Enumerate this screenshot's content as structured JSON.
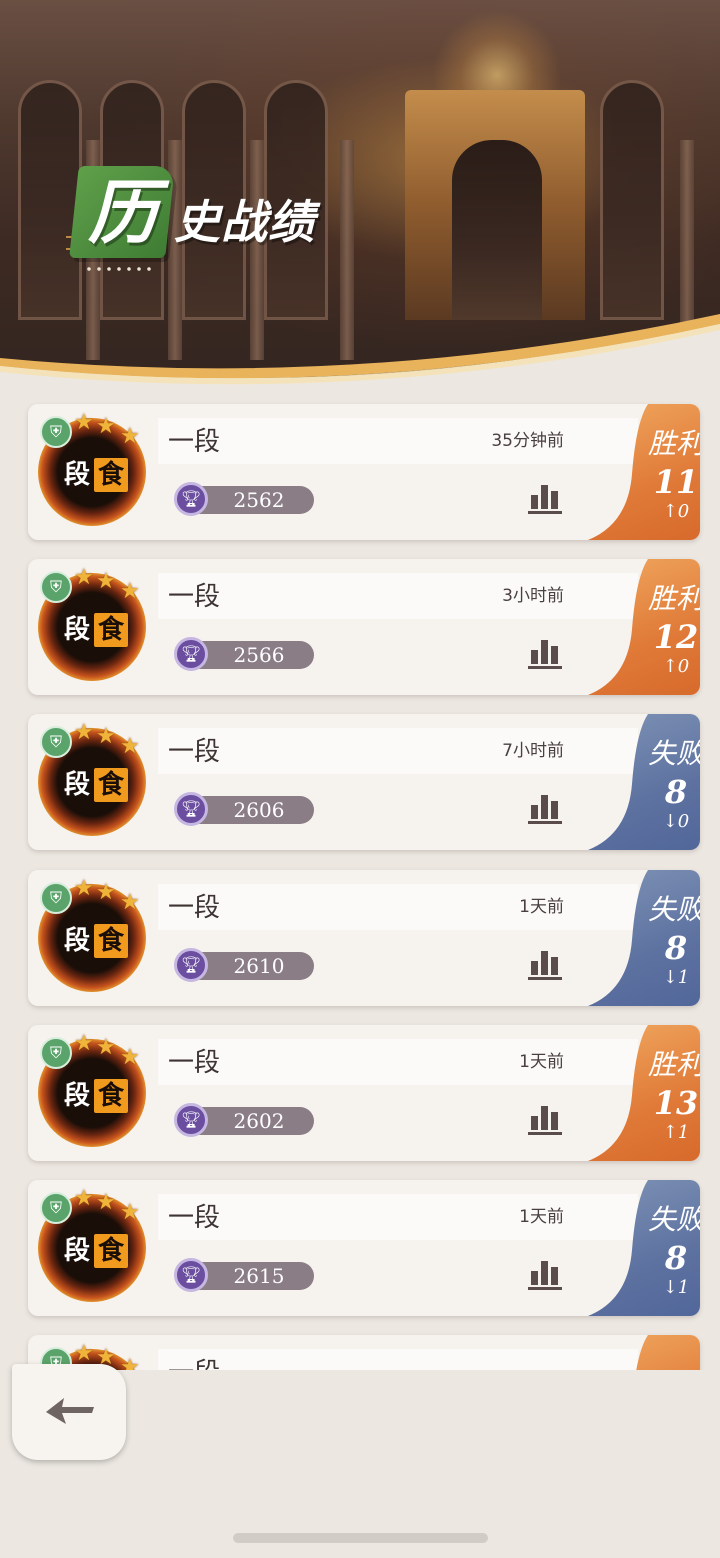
{
  "header": {
    "title_char": "历",
    "title_rest": "史战绩"
  },
  "matches": [
    {
      "rank": "一段",
      "time": "35分钟前",
      "score": "2562",
      "result": "胜利",
      "result_type": "win",
      "number": "11",
      "delta": "↑0"
    },
    {
      "rank": "一段",
      "time": "3小时前",
      "score": "2566",
      "result": "胜利",
      "result_type": "win",
      "number": "12",
      "delta": "↑0"
    },
    {
      "rank": "一段",
      "time": "7小时前",
      "score": "2606",
      "result": "失败",
      "result_type": "loss",
      "number": "8",
      "delta": "↓0"
    },
    {
      "rank": "一段",
      "time": "1天前",
      "score": "2610",
      "result": "失败",
      "result_type": "loss",
      "number": "8",
      "delta": "↓1"
    },
    {
      "rank": "一段",
      "time": "1天前",
      "score": "2602",
      "result": "胜利",
      "result_type": "win",
      "number": "13",
      "delta": "↑1"
    },
    {
      "rank": "一段",
      "time": "1天前",
      "score": "2615",
      "result": "失败",
      "result_type": "loss",
      "number": "8",
      "delta": "↓1"
    },
    {
      "rank": "一段",
      "time": "",
      "score": "",
      "result": "",
      "result_type": "win",
      "number": "",
      "delta": ""
    }
  ],
  "badge": {
    "char1": "段",
    "char2": "食"
  },
  "colors": {
    "win": "#e07a38",
    "loss": "#5d72a0",
    "title_green": "#4f8f3f",
    "background": "#ece7e1"
  },
  "icons": {
    "back": "back-arrow-icon",
    "stats": "bar-chart-icon",
    "trophy": "trophy-icon",
    "shield": "shield-icon"
  }
}
